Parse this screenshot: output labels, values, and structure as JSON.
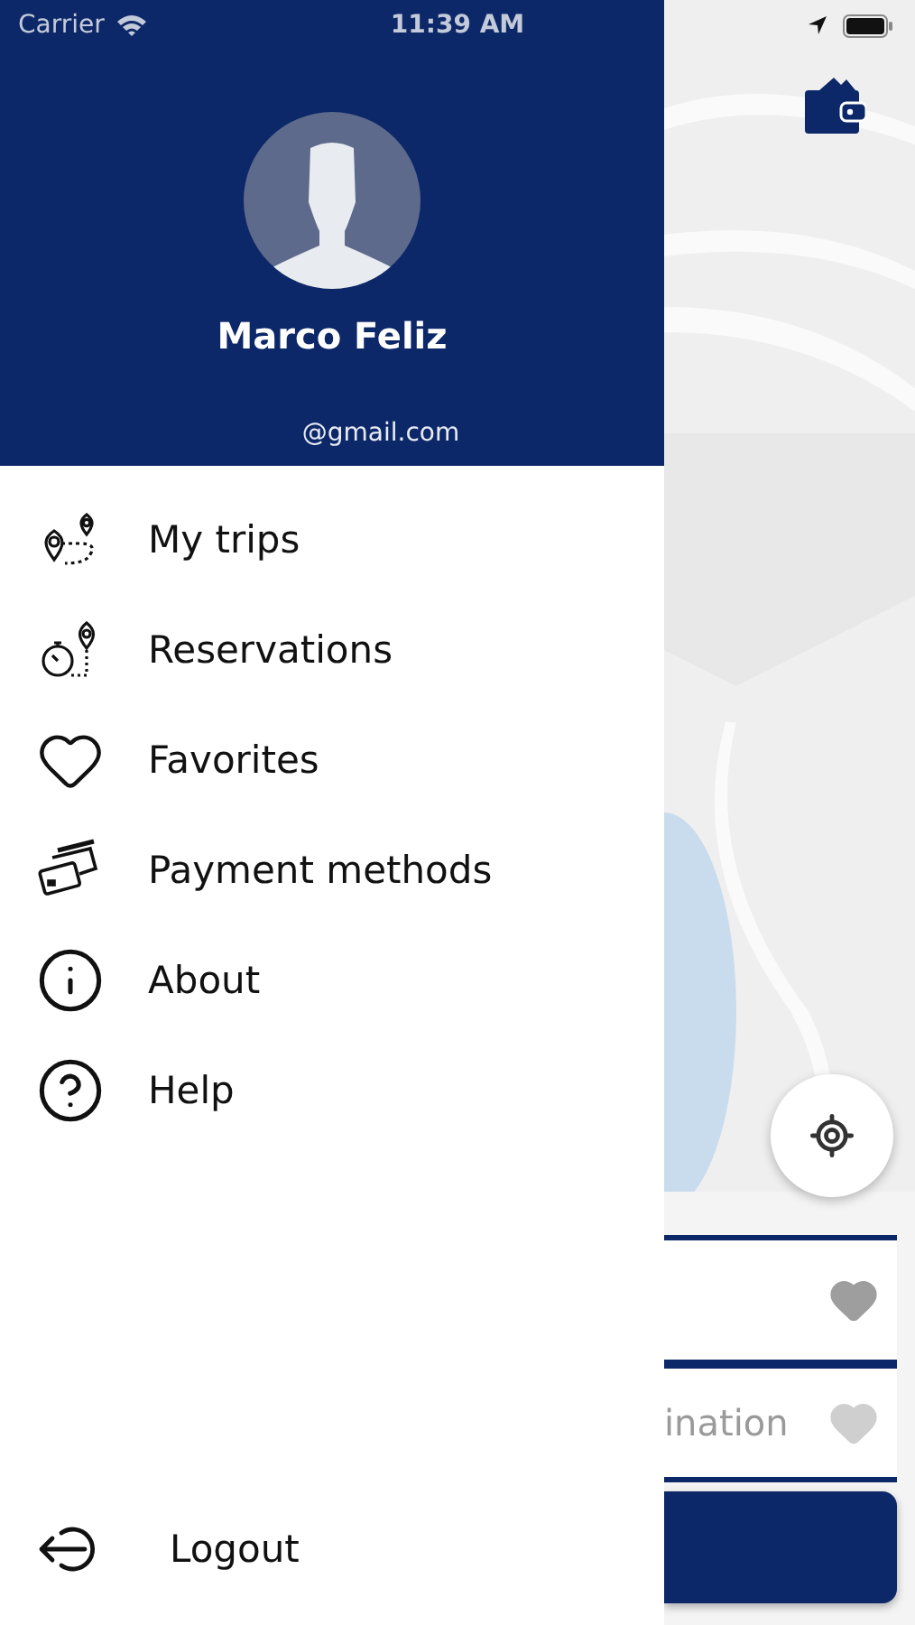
{
  "status_bar": {
    "carrier": "Carrier",
    "time": "11:39 AM"
  },
  "profile": {
    "name": "Marco Feliz",
    "email": "@gmail.com"
  },
  "menu": [
    {
      "label": "My trips",
      "kind": "trips"
    },
    {
      "label": "Reservations",
      "kind": "stopwatch"
    },
    {
      "label": "Favorites",
      "kind": "heart"
    },
    {
      "label": "Payment methods",
      "kind": "cards"
    },
    {
      "label": "About",
      "kind": "info"
    },
    {
      "label": "Help",
      "kind": "help"
    }
  ],
  "logout": {
    "label": "Logout"
  },
  "map_panel": {
    "destination_text": "ination"
  }
}
